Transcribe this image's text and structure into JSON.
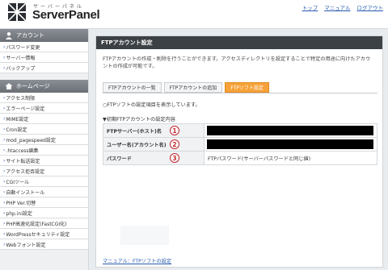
{
  "header": {
    "logo_kana": "サーバーパネル",
    "logo_text": "ServerPanel",
    "nav": [
      "トップ",
      "マニュアル",
      "ログアウト"
    ]
  },
  "sidebar": {
    "account_title": "アカウント",
    "account_items": [
      "パスワード変更",
      "サーバー情報",
      "バックアップ"
    ],
    "homepage_title": "ホームページ",
    "homepage_items": [
      "アクセス制限",
      "エラーページ設定",
      "MIME設定",
      "Cron設定",
      "mod_pagespeed設定",
      ".htaccess編集",
      "サイト転送設定",
      "アクセス拒否設定",
      "CGIツール",
      "自動インストール",
      "PHP Ver.切替",
      "php.ini設定",
      "PHP高速化設定(FastCGI化)",
      "WordPressセキュリティ設定",
      "Webフォント設定"
    ]
  },
  "main": {
    "title": "FTPアカウント設定",
    "intro_line1": "FTPアカウントの作成・削除を行うことができます。アクセスディレクトリを設定することで特定の用途に向けたアカウ",
    "intro_line2": "ントの作成が可能です。",
    "tabs": [
      "FTPアカウントの一覧",
      "FTPアカウントの追加",
      "FTPソフト設定"
    ],
    "note": "○FTPソフトの設定項目を表示しています。",
    "subhead": "▼初期FTPアカウントの設定内容",
    "rows": [
      {
        "label": "FTPサーバー(ホスト)名",
        "marker": "1",
        "value": ""
      },
      {
        "label": "ユーザー名(アカウント名)",
        "marker": "2",
        "value": ""
      },
      {
        "label": "パスワード",
        "marker": "3",
        "value": "FTPパスワード(サーバーパスワードと同じ値)"
      }
    ],
    "manual_link": "マニュアル：FTPソフトの設定"
  },
  "colors": {
    "accent_tab": "#f7a23a",
    "title_bar": "#3c4146",
    "link": "#2a5db0",
    "marker": "#c2272d"
  }
}
